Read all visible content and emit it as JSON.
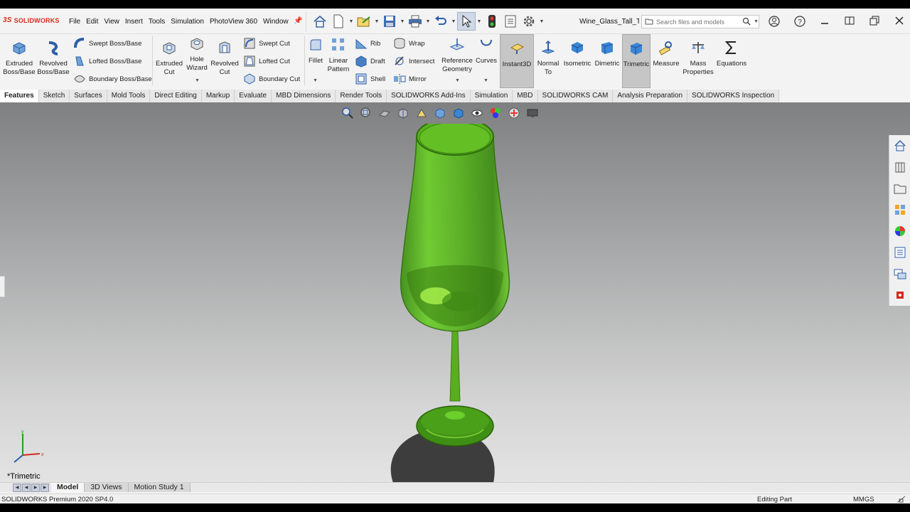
{
  "app": {
    "logo_text": "SOLIDWORKS",
    "logo_mark": "3S",
    "menus": [
      "File",
      "Edit",
      "View",
      "Insert",
      "Tools",
      "Simulation",
      "PhotoView 360",
      "Window"
    ],
    "document_title": "Wine_Glass_Tall_Ta...",
    "search_placeholder": "Search files and models"
  },
  "commands": {
    "extruded_boss": "Extruded Boss/Base",
    "revolved_boss": "Revolved Boss/Base",
    "swept_boss": "Swept Boss/Base",
    "lofted_boss": "Lofted Boss/Base",
    "boundary_boss": "Boundary Boss/Base",
    "extruded_cut": "Extruded Cut",
    "hole_wizard": "Hole Wizard",
    "revolved_cut": "Revolved Cut",
    "swept_cut": "Swept Cut",
    "lofted_cut": "Lofted Cut",
    "boundary_cut": "Boundary Cut",
    "fillet": "Fillet",
    "linear_pattern": "Linear Pattern",
    "rib": "Rib",
    "draft": "Draft",
    "shell": "Shell",
    "wrap": "Wrap",
    "intersect": "Intersect",
    "mirror": "Mirror",
    "reference_geometry": "Reference Geometry",
    "curves": "Curves",
    "instant3d": "Instant3D",
    "normal_to": "Normal To",
    "isometric": "Isometric",
    "dimetric": "Dimetric",
    "trimetric": "Trimetric",
    "measure": "Measure",
    "mass_properties": "Mass Properties",
    "equations": "Equations"
  },
  "tabs": [
    "Features",
    "Sketch",
    "Surfaces",
    "Mold Tools",
    "Direct Editing",
    "Markup",
    "Evaluate",
    "MBD Dimensions",
    "Render Tools",
    "SOLIDWORKS Add-Ins",
    "Simulation",
    "MBD",
    "SOLIDWORKS CAM",
    "Analysis Preparation",
    "SOLIDWORKS Inspection"
  ],
  "active_tab": "Features",
  "viewport": {
    "view_name": "*Trimetric",
    "axes": {
      "x": "x",
      "y": "y"
    },
    "model_color": "#5fb81e"
  },
  "bottom_tabs": [
    "Model",
    "3D Views",
    "Motion Study 1"
  ],
  "status": {
    "product": "SOLIDWORKS Premium 2020 SP4.0",
    "mode": "Editing Part",
    "units": "MMGS"
  }
}
